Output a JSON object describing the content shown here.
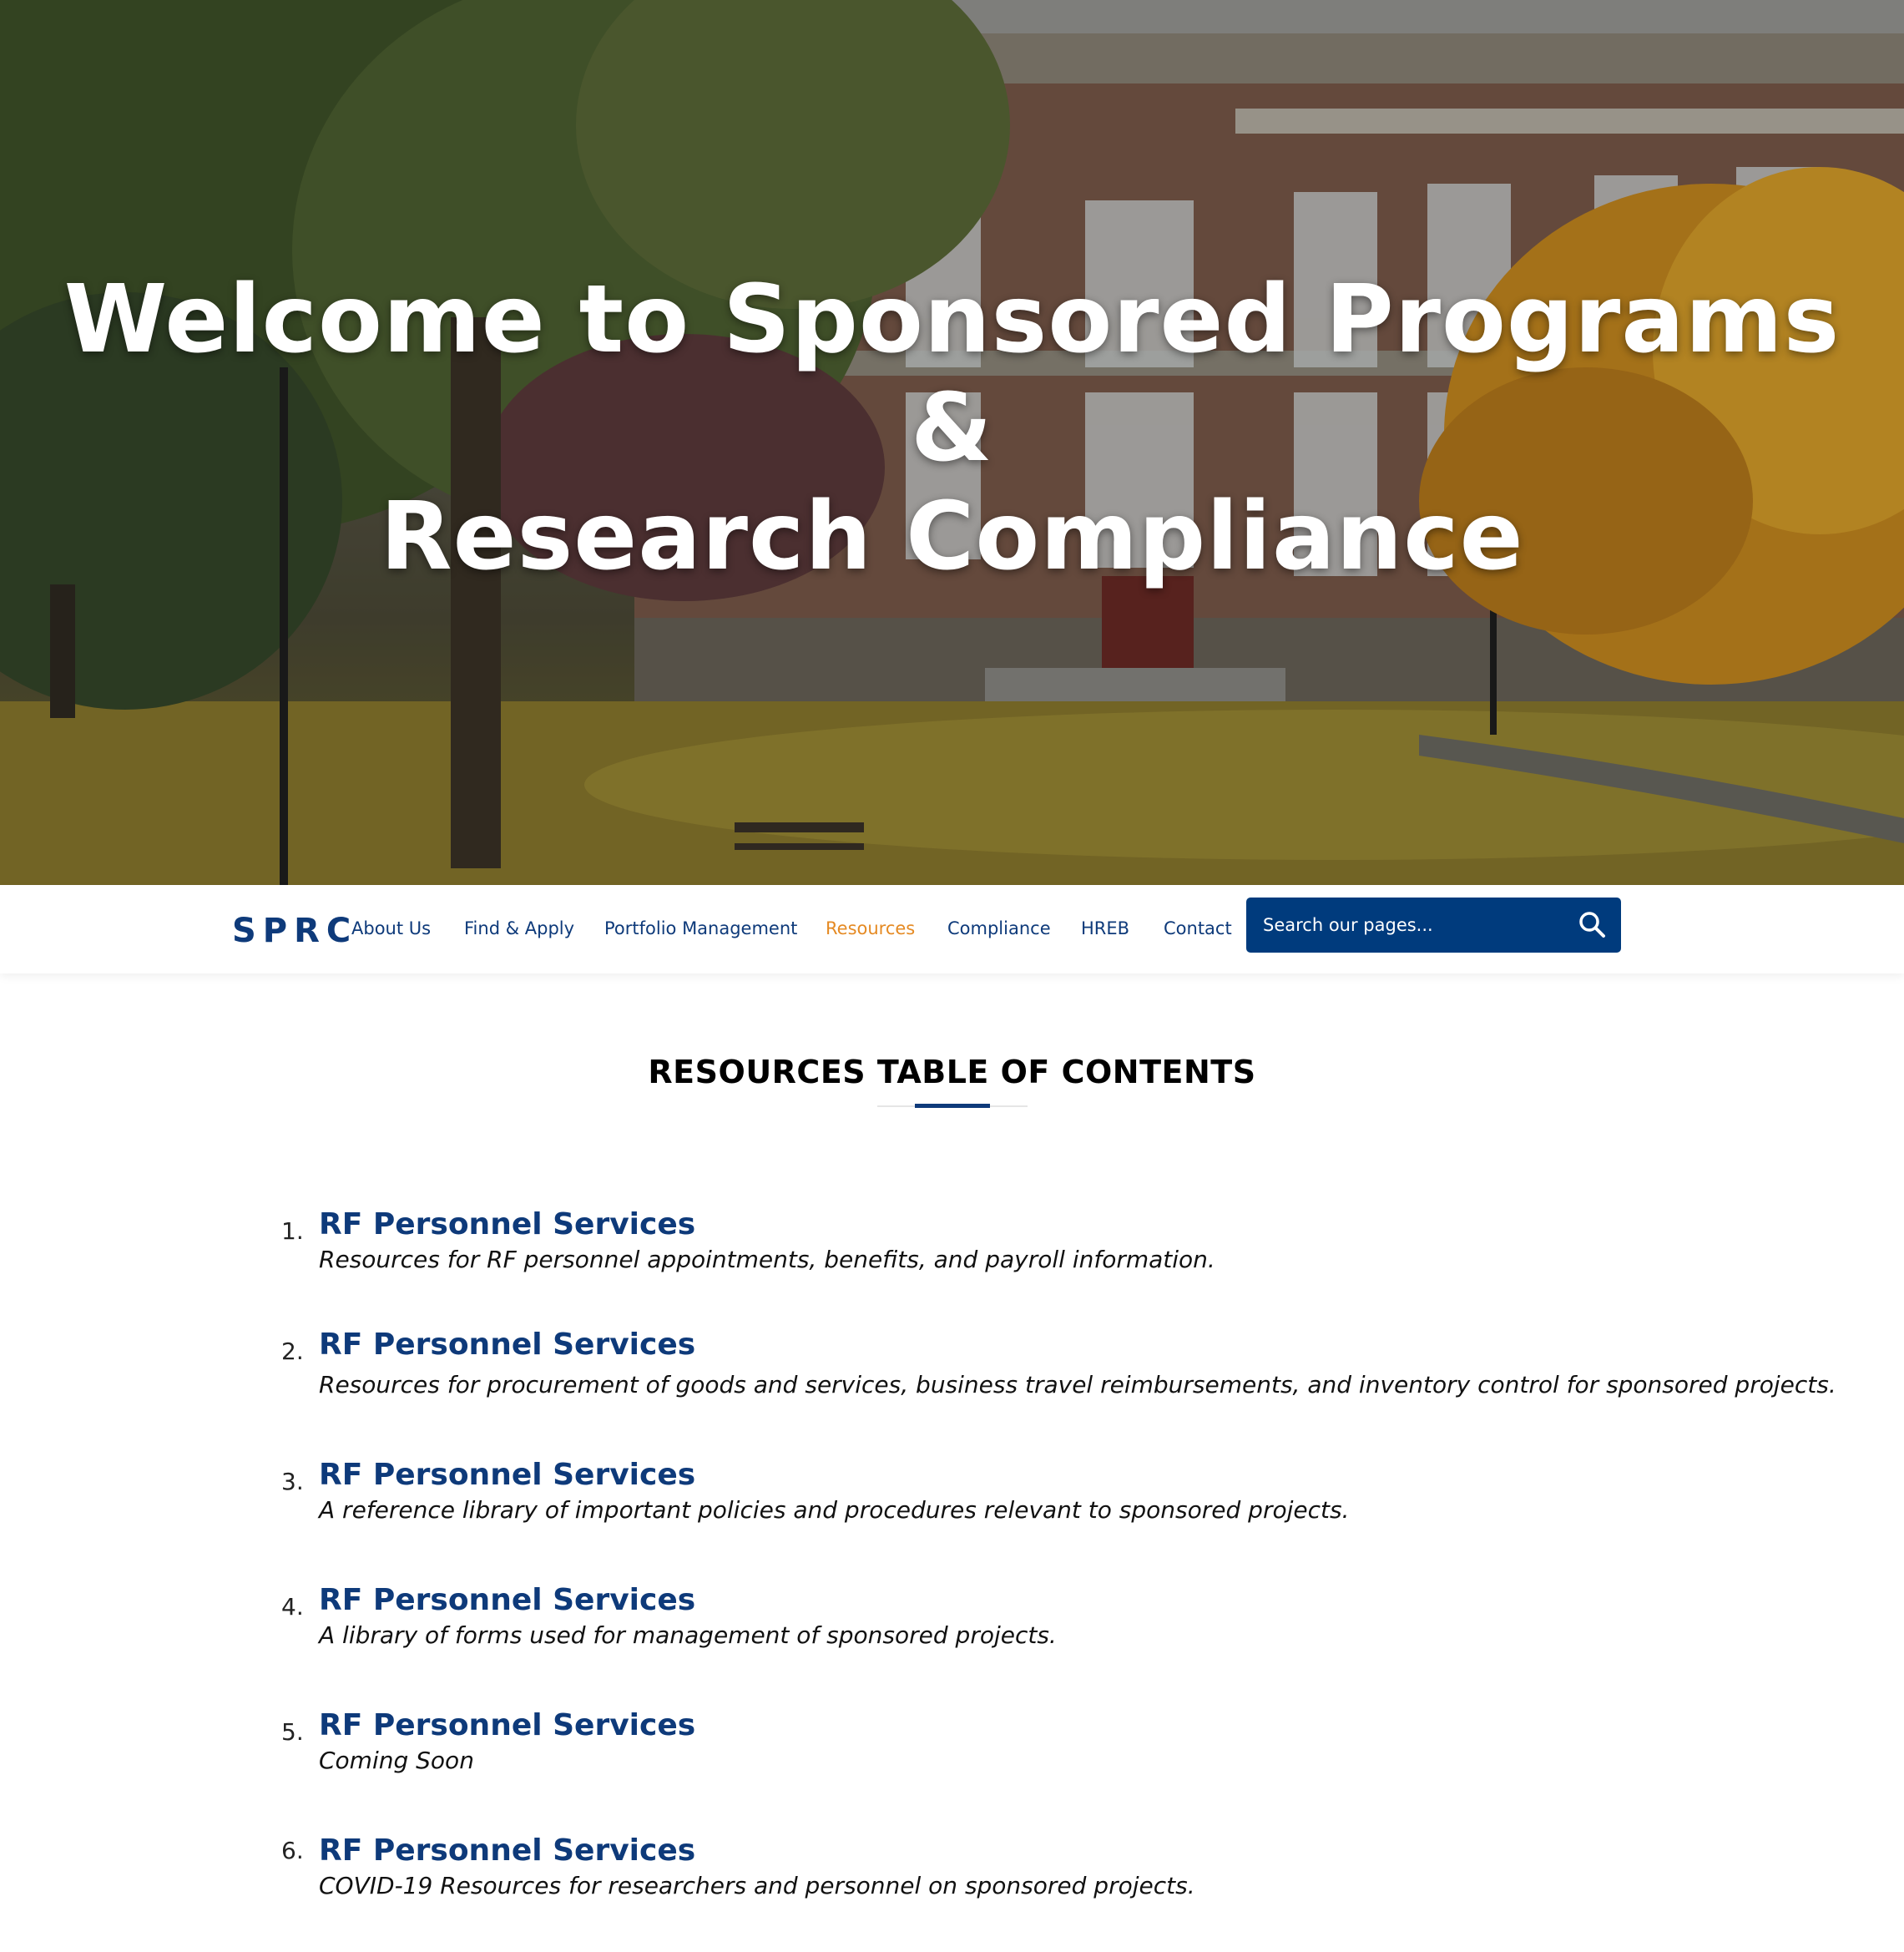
{
  "hero": {
    "title_line1": "Welcome to Sponsored Programs",
    "title_line2": "&",
    "title_line3": "Research Compliance"
  },
  "nav": {
    "brand": "SPRC",
    "items": [
      {
        "label": "About Us"
      },
      {
        "label": "Find & Apply"
      },
      {
        "label": "Portfolio Management"
      },
      {
        "label": "Resources",
        "active": true
      },
      {
        "label": "Compliance"
      },
      {
        "label": "HREB"
      },
      {
        "label": "Contact"
      }
    ],
    "search": {
      "placeholder": "Search our pages...",
      "icon": "search-icon"
    }
  },
  "main": {
    "section_title": "RESOURCES TABLE OF CONTENTS",
    "items": [
      {
        "number": "1.",
        "title": "RF Personnel Services",
        "description": "Resources for RF personnel appointments, benefits, and payroll information."
      },
      {
        "number": "2.",
        "title": "RF Personnel Services",
        "description": "Resources for procurement of goods and services, business travel reimbursements, and inventory control for sponsored projects."
      },
      {
        "number": "3.",
        "title": "RF Personnel Services",
        "description": "A reference library of important policies and procedures relevant to sponsored projects."
      },
      {
        "number": "4.",
        "title": "RF Personnel Services",
        "description": "A library of forms used for management of sponsored projects."
      },
      {
        "number": "5.",
        "title": "RF Personnel Services",
        "description": "Coming Soon"
      },
      {
        "number": "6.",
        "title": "RF Personnel Services",
        "description": "COVID-19 Resources for researchers and personnel on sponsored projects."
      }
    ]
  },
  "colors": {
    "brand": "#0e3a7a",
    "active_nav": "#e58a23",
    "search_bg": "#003b7d"
  }
}
